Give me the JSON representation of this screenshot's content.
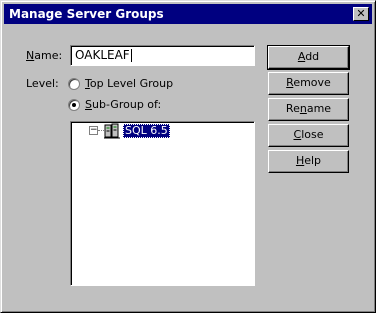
{
  "window": {
    "title": "Manage Server Groups",
    "close_glyph": "✕"
  },
  "form": {
    "name_label": "Name:",
    "name_value": "OAKLEAF",
    "level_label": "Level:",
    "radio_top_level": "Top Level Group",
    "radio_subgroup": "Sub-Group of:",
    "selected_level": "Sub-Group of:"
  },
  "tree": {
    "expander_glyph": "−",
    "nodes": [
      {
        "label": "SQL 6.5",
        "icon": "server-icon",
        "selected": true
      }
    ]
  },
  "buttons": {
    "add": "Add",
    "remove": "Remove",
    "rename": "Rename",
    "close": "Close",
    "help": "Help"
  }
}
